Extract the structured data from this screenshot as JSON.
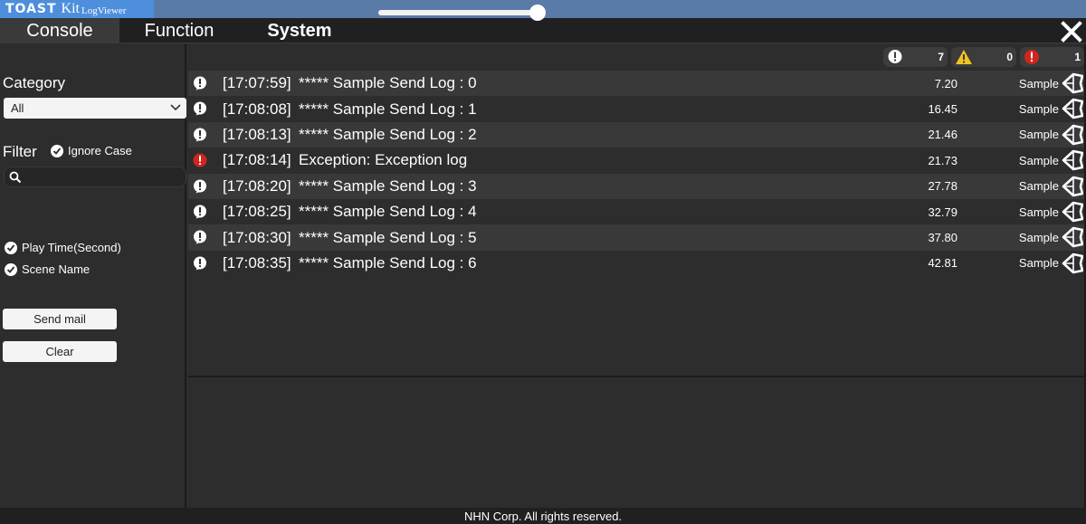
{
  "app": {
    "logo_brand": "TOAST",
    "logo_kit": "Kit",
    "logo_viewer": "LogViewer"
  },
  "tabs": [
    "Console",
    "Function",
    "System"
  ],
  "left": {
    "category_label": "Category",
    "category_value": "All",
    "filter_label": "Filter",
    "ignore_case_label": "Ignore Case",
    "play_time_label": "Play Time(Second)",
    "scene_name_label": "Scene Name",
    "send_mail_label": "Send mail",
    "clear_label": "Clear"
  },
  "counters": {
    "log": "7",
    "warning": "0",
    "error": "1"
  },
  "logs": [
    {
      "type": "log",
      "time": "[17:07:59]",
      "message": "***** Sample Send Log : 0",
      "play_time": "7.20",
      "scene": "Sample"
    },
    {
      "type": "log",
      "time": "[17:08:08]",
      "message": "***** Sample Send Log : 1",
      "play_time": "16.45",
      "scene": "Sample"
    },
    {
      "type": "log",
      "time": "[17:08:13]",
      "message": "***** Sample Send Log : 2",
      "play_time": "21.46",
      "scene": "Sample"
    },
    {
      "type": "error",
      "time": "[17:08:14]",
      "message": "Exception: Exception log",
      "play_time": "21.73",
      "scene": "Sample"
    },
    {
      "type": "log",
      "time": "[17:08:20]",
      "message": "***** Sample Send Log : 3",
      "play_time": "27.78",
      "scene": "Sample"
    },
    {
      "type": "log",
      "time": "[17:08:25]",
      "message": "***** Sample Send Log : 4",
      "play_time": "32.79",
      "scene": "Sample"
    },
    {
      "type": "log",
      "time": "[17:08:30]",
      "message": "***** Sample Send Log : 5",
      "play_time": "37.80",
      "scene": "Sample"
    },
    {
      "type": "log",
      "time": "[17:08:35]",
      "message": "***** Sample Send Log : 6",
      "play_time": "42.81",
      "scene": "Sample"
    }
  ],
  "footer": "NHN Corp. All rights reserved.",
  "colors": {
    "accent": "#4d8fdc",
    "error": "#d0261d",
    "warning": "#f2c31f",
    "background": "#2d2d2d"
  },
  "icons": {
    "log": "info-bubble-icon",
    "warning": "warning-triangle-icon",
    "error": "error-circle-icon",
    "scene": "unity-icon"
  }
}
